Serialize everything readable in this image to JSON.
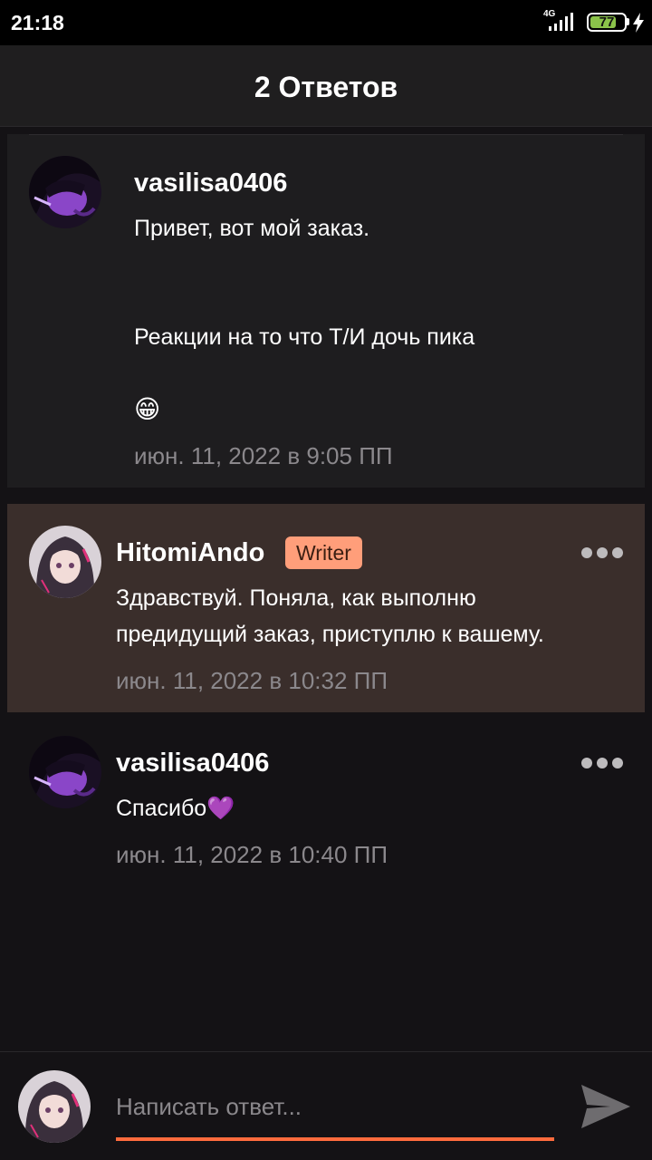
{
  "status_bar": {
    "time": "21:18",
    "network": "4G",
    "battery": "77",
    "battery_level": 0.77
  },
  "header": {
    "title": "2 Ответов"
  },
  "comments": [
    {
      "username": "vasilisa0406",
      "lines": [
        "Привет, вот мой заказ.",
        "",
        "",
        "Реакции на то что Т/И дочь пика",
        "",
        "😁"
      ],
      "timestamp": "июн. 11, 2022 в 9:05 ПП",
      "avatar": "avatar-purple"
    },
    {
      "username": "HitomiAndo",
      "badge": "Writer",
      "lines": [
        "Здравствуй. Поняла, как выполню",
        "предидущий заказ, приступлю к вашему."
      ],
      "timestamp": "июн. 11, 2022 в 10:32 ПП",
      "avatar": "avatar-anime-girl"
    },
    {
      "username": "vasilisa0406",
      "lines": [
        "Спасибо💜"
      ],
      "timestamp": "июн. 11, 2022 в 10:40 ПП",
      "avatar": "avatar-purple"
    }
  ],
  "reply": {
    "placeholder": "Написать ответ...",
    "send_icon": "send-icon"
  },
  "colors": {
    "accent": "#ff6b3d",
    "badge": "#ff9e7a",
    "highlight_bg": "#3a2e2b",
    "battery": "#8bc34a"
  }
}
